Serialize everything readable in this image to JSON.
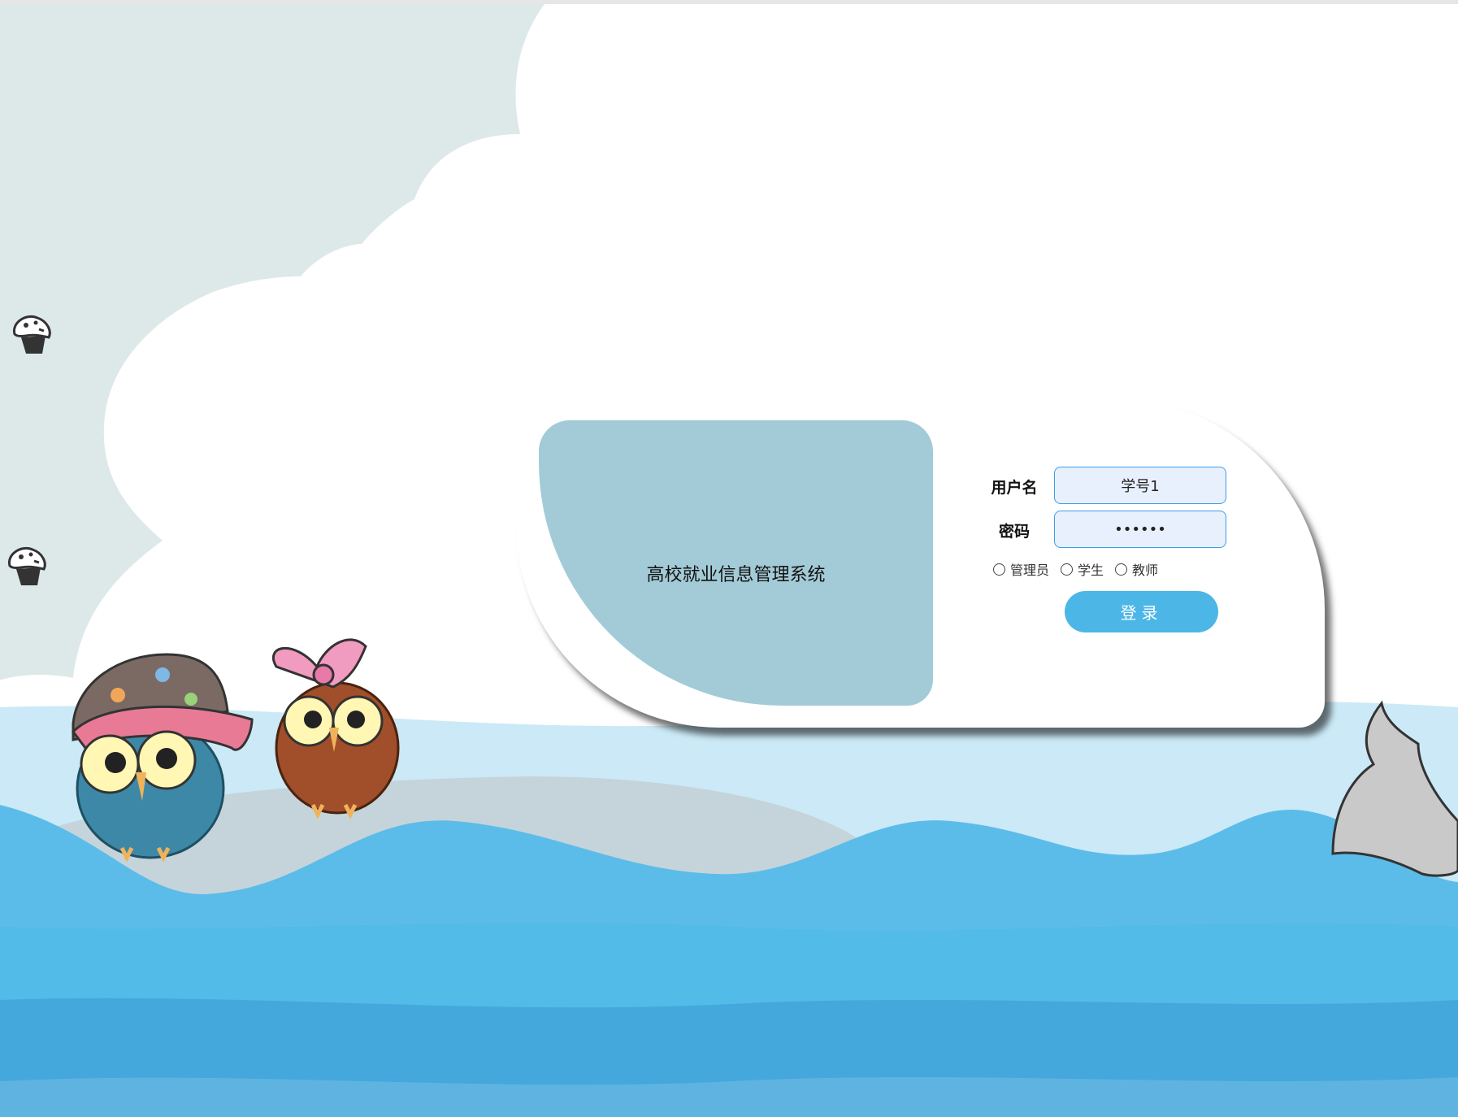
{
  "app": {
    "title": "高校就业信息管理系统"
  },
  "login": {
    "username_label": "用户名",
    "username_value": "学号1",
    "password_label": "密码",
    "password_mask": "••••••",
    "roles": [
      "管理员",
      "学生",
      "教师"
    ],
    "submit_label": "登录"
  },
  "icons": {
    "decor_top": "cupcake-icon",
    "decor_bottom": "cupcake-icon",
    "owl_left": "owl-with-cap",
    "owl_right": "owl-with-bow",
    "tail": "whale-tail"
  },
  "colors": {
    "sky": "#dde9e8",
    "panel": "#a3cbd7",
    "input_bg": "#e8f0fe",
    "button": "#4cb6e6",
    "sea_light": "#cbe9f6",
    "sea_mid": "#5cbce9",
    "sea_deep": "#42a7dd"
  }
}
